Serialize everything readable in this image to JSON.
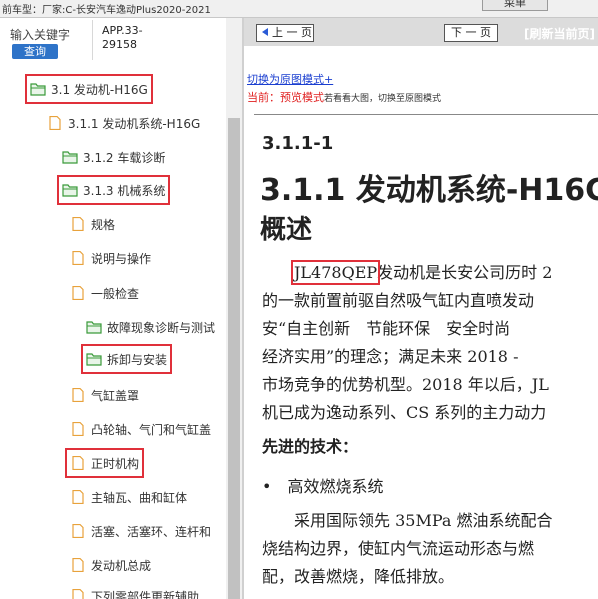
{
  "topbar": {
    "vehicle_title": "前车型：厂家:C-长安汽车逸动Plus2020-2021",
    "top_button": "菜单"
  },
  "left_panel": {
    "search_label": "输入关键字",
    "search_button": "查询",
    "app_code_line1": "APP.33-",
    "app_code_line2": "29158"
  },
  "tree": {
    "items": [
      {
        "label": "3.1 发动机-H16G",
        "icon": "folder-open-icon"
      },
      {
        "label": "3.1.1 发动机系统-H16G",
        "icon": "document-icon"
      },
      {
        "label": "3.1.2 车载诊断",
        "icon": "folder-open-icon"
      },
      {
        "label": "3.1.3 机械系统",
        "icon": "folder-open-icon"
      },
      {
        "label": "规格",
        "icon": "document-icon"
      },
      {
        "label": "说明与操作",
        "icon": "document-icon"
      },
      {
        "label": "一般检查",
        "icon": "document-icon"
      },
      {
        "label": "故障现象诊断与测试",
        "icon": "folder-open-icon"
      },
      {
        "label": "拆卸与安装",
        "icon": "folder-open-icon"
      },
      {
        "label": "气缸盖罩",
        "icon": "document-icon"
      },
      {
        "label": "凸轮轴、气门和气缸盖",
        "icon": "document-icon"
      },
      {
        "label": "正时机构",
        "icon": "document-icon"
      },
      {
        "label": "主轴瓦、曲和缸体",
        "icon": "document-icon"
      },
      {
        "label": "活塞、活塞环、连杆和",
        "icon": "document-icon"
      },
      {
        "label": "发动机总成",
        "icon": "document-icon"
      },
      {
        "label": "下列零部件更新辅助",
        "icon": "document-icon"
      }
    ]
  },
  "viewer": {
    "prev_button": "上 一 页",
    "next_button": "下 一 页",
    "refresh_link": "[刷新当前页]",
    "switch_link": "切换为原图模式+",
    "current_prefix": "当前：",
    "current_mode": "预览模式",
    "mode_note": "若看看大图，切换至原图模式"
  },
  "document": {
    "section_code": "3.1.1-1",
    "section_title": "3.1.1 发动机系统-H16G",
    "overview": "概述",
    "engine_code": "JL478QEP",
    "p1_line1_rest": "发动机是长安公司历时 2",
    "p1_line2": "的一款前置前驱自然吸气缸内直喷发动",
    "p1_line3": "安“自主创新　节能环保　安全时尚",
    "p1_line4": "经济实用”的理念；满足未来 2018 -",
    "p1_line5": "市场竞争的优势机型。2018 年以后，JL",
    "p1_line6": "机已成为逸动系列、CS 系列的主力动力",
    "advanced_title": "先进的技术：",
    "bullet": "高效燃烧系统",
    "p2_line1": "　　采用国际领先 35MPa 燃油系统配合",
    "p2_line2": "烧结构边界，使缸内气流运动形态与燃",
    "p2_line3": "配，改善燃烧，降低排放。"
  },
  "colors": {
    "highlight": "#e0303a",
    "folder": "#3a9a3a",
    "document": "#e8a23c",
    "link": "#1a3ed0",
    "search_button": "#2e73c8"
  }
}
